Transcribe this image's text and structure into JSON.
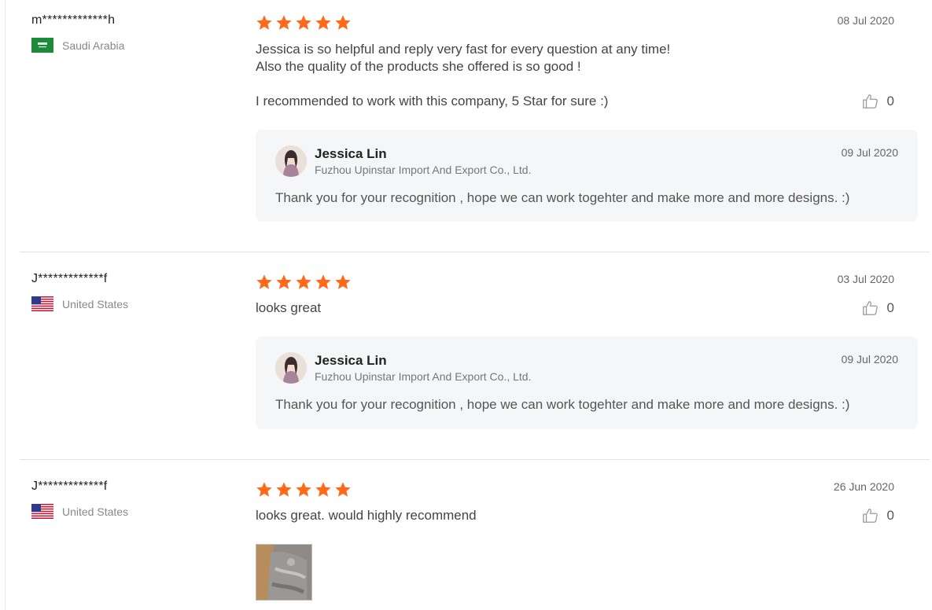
{
  "reviews": [
    {
      "username": "m*************h",
      "country": "Saudi Arabia",
      "rating_stars": 5,
      "date": "08 Jul 2020",
      "text_lines": [
        "Jessica is so helpful and reply very fast for every question at any time!",
        "Also the quality of the products she offered is so good !",
        "I recommended to work with this company, 5 Star for sure :)"
      ],
      "likes": "0",
      "reply": {
        "name": "Jessica Lin",
        "company": "Fuzhou Upinstar Import And Export Co., Ltd.",
        "date": "09 Jul 2020",
        "text": "Thank you for your recognition , hope we can work togehter and make more and more designs. :)"
      }
    },
    {
      "username": "J*************f",
      "country": "United States",
      "rating_stars": 5,
      "date": "03 Jul 2020",
      "text_lines": [
        "looks great"
      ],
      "likes": "0",
      "reply": {
        "name": "Jessica Lin",
        "company": "Fuzhou Upinstar Import And Export Co., Ltd.",
        "date": "09 Jul 2020",
        "text": "Thank you for your recognition , hope we can work togehter and make more and more designs. :)"
      }
    },
    {
      "username": "J*************f",
      "country": "United States",
      "rating_stars": 5,
      "date": "26 Jun 2020",
      "text_lines": [
        "looks great. would highly recommend"
      ],
      "likes": "0",
      "has_photo": true
    }
  ],
  "colors": {
    "star": "#ff6a1a",
    "reply_bg": "#f5f6f7",
    "divider": "#e2e2e2"
  },
  "icons": {
    "star": "star-icon",
    "like": "thumbs-up-icon",
    "flag_sa": "saudi-arabia-flag-icon",
    "flag_us": "united-states-flag-icon"
  }
}
